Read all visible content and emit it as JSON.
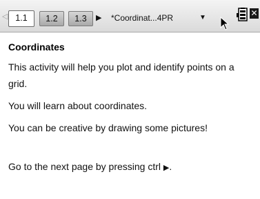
{
  "tabs": {
    "scroll_left_glyph": "◁",
    "items": [
      {
        "label": "1.1",
        "active": true
      },
      {
        "label": "1.2",
        "active": false
      },
      {
        "label": "1.3",
        "active": false
      }
    ],
    "more_glyph": "▶",
    "document_title": "*Coordinat...4PR",
    "document_caret": "▼",
    "close_glyph": "✕"
  },
  "page": {
    "heading": "Coordinates",
    "paragraphs": [
      "This activity will help you plot and identify points on a grid.",
      "You will learn about coordinates.",
      "You can be creative by drawing some pictures!",
      "Go to the next page by pressing ctrl"
    ],
    "next_arrow": "▶",
    "next_period": "."
  },
  "colors": {
    "tabbar_bg": "#e4e4e4",
    "inactive_tab": "#bdbdbd",
    "active_tab": "#ffffff",
    "text": "#111111"
  },
  "icons": {
    "cursor": "mouse-pointer-icon",
    "battery": "battery-icon",
    "close": "close-icon"
  }
}
